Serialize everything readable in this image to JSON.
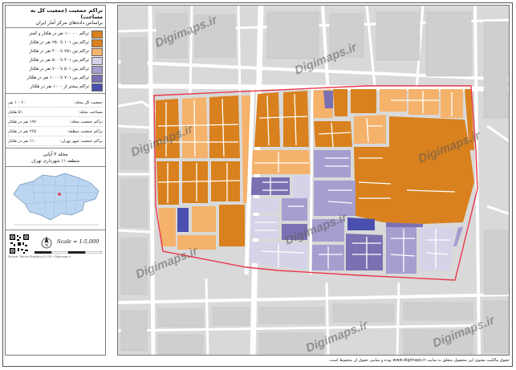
{
  "title": {
    "line1": "تراکم جمعیت (جمعیت کل به مساحت)",
    "line2": "براساس داده‌های مرکز آمار ایران"
  },
  "legend": [
    {
      "label": "تراکم ۰ - ۱۰۰ نفر در هکتار و کمتر",
      "color": "#d9811e"
    },
    {
      "label": "تراکم بین ۱۰۱ تا ۲۵۰ نفر در هکتار",
      "color": "#d9811e"
    },
    {
      "label": "تراکم بین ۲۵۱ تا ۴۰۰ نفر در هکتار",
      "color": "#f5b26b"
    },
    {
      "label": "تراکم بین ۴۰۱ تا ۵۰۰ نفر در هکتار",
      "color": "#d4d3e8"
    },
    {
      "label": "تراکم بین ۵۰۱ تا ۷۰۰ نفر در هکتار",
      "color": "#a59fcf"
    },
    {
      "label": "تراکم بین ۷۰۱ تا ۱۰۰۰ نفر در هکتار",
      "color": "#7b70b2"
    },
    {
      "label": "تراکم بیشتر از ۱۰۰۰ نفر در هکتار",
      "color": "#4b4fb0"
    }
  ],
  "stats": [
    {
      "label": "جمعیت کل محله:",
      "value": "۱۰۰۶۰ نفر"
    },
    {
      "label": "مساحت محله:",
      "value": "۵۱ هکتار"
    },
    {
      "label": "تراکم جمعیت محله:",
      "value": "۱۹۷ نفر در هکتار"
    },
    {
      "label": "تراکم جمعیت منطقه:",
      "value": "۲۶۵ نفر در هکتار"
    },
    {
      "label": "تراکم جمعیت شهر تهران:",
      "value": "۱۱۰ نفر در هکتار"
    }
  ],
  "district": {
    "name": "محله ۳ آبانی",
    "region": "منطقه ۱۱ شهرداری تهران"
  },
  "scale": "Scale = 1:5,000",
  "watermark": "Digimaps.ir",
  "footer": "حقوق مالکیت معنوی این محصول متعلق به سایت www.digimaps.ir بوده و تمامی حقوق آن محفوظ است.",
  "credit": "Source: Tehran Statistics & GIS • Digimaps.ir",
  "colors": {
    "orange": "#d9811e",
    "light_orange": "#f5b26b",
    "lavender": "#d4d3e8",
    "light_purple": "#a59fcf",
    "purple": "#7b70b2",
    "blue": "#4b4fb0",
    "boundary": "#e8384a",
    "road": "#ffffff",
    "background": "#d9d9d9"
  }
}
